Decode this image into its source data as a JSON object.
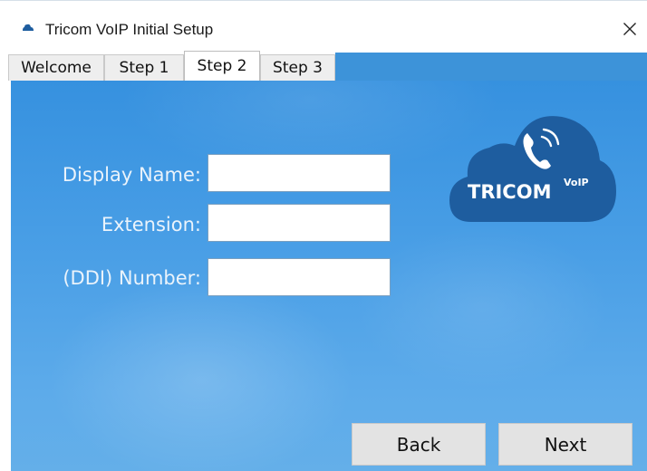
{
  "window": {
    "title": "Tricom VoIP Initial Setup"
  },
  "tabs": [
    {
      "label": "Welcome"
    },
    {
      "label": "Step 1"
    },
    {
      "label": "Step 2",
      "active": true
    },
    {
      "label": "Step 3"
    }
  ],
  "form": {
    "display_name": {
      "label": "Display Name:",
      "value": ""
    },
    "extension": {
      "label": "Extension:",
      "value": ""
    },
    "ddi_number": {
      "label": "(DDI) Number:",
      "value": ""
    }
  },
  "logo": {
    "brand": "TRICOM",
    "superscript": "VoIP",
    "icon": "phone-signal-icon"
  },
  "buttons": {
    "back": "Back",
    "next": "Next"
  },
  "colors": {
    "panel_blue": "#4a9fe6",
    "logo_cloud": "#1e5d9f",
    "active_tab": "#ffffff"
  }
}
